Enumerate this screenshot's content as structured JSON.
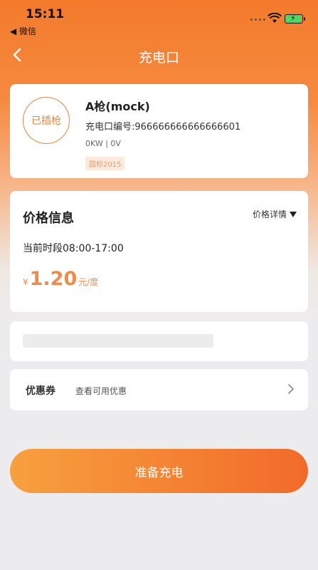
{
  "status_bar": {
    "time": "15:11",
    "back_app": "◀ 微信"
  },
  "nav": {
    "title": "充电口"
  },
  "gun": {
    "status": "已插枪",
    "name": "A枪(mock)",
    "code": "充电口编号:966666666666666601",
    "power": "0KW | 0V",
    "standard_tag": "国标2015"
  },
  "price": {
    "title": "价格信息",
    "detail_label": "价格详情",
    "period": "当前时段08:00-17:00",
    "currency": "¥",
    "value": "1.20",
    "unit": "元/度"
  },
  "coupon": {
    "label": "优惠券",
    "hint": "查看可用优惠"
  },
  "action": {
    "charge_label": "准备充电"
  },
  "colors": {
    "accent": "#f58534",
    "price": "#f08b4a",
    "tag_bg": "#fdeadd"
  },
  "icons": {
    "back": "chevron-left-icon",
    "detail": "triangle-down-icon",
    "coupon_more": "chevron-right-icon"
  }
}
